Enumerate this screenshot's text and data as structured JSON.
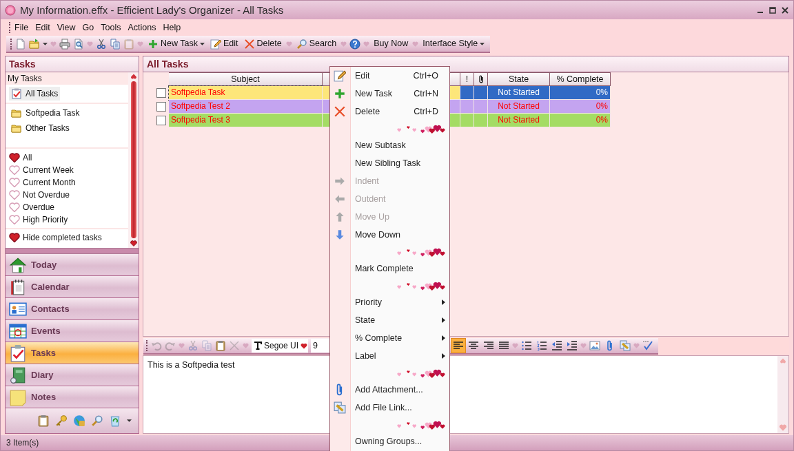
{
  "window": {
    "title": "My Information.effx - Efficient Lady's Organizer - All Tasks"
  },
  "menu": [
    "File",
    "Edit",
    "View",
    "Go",
    "Tools",
    "Actions",
    "Help"
  ],
  "toolbar": [
    {
      "kind": "icon",
      "disabled": false
    },
    {
      "kind": "icon-menu",
      "disabled": false
    },
    {
      "kind": "separator"
    },
    {
      "kind": "icon",
      "disabled": false
    },
    {
      "kind": "icon",
      "disabled": false
    },
    {
      "kind": "separator"
    },
    {
      "kind": "icon",
      "disabled": false
    },
    {
      "kind": "icon",
      "disabled": false
    },
    {
      "kind": "icon",
      "disabled": true
    },
    {
      "kind": "separator"
    },
    {
      "kind": "button-menu",
      "label": "New Task",
      "disabled": false
    },
    {
      "kind": "button",
      "label": "Edit",
      "disabled": false
    },
    {
      "kind": "button",
      "label": "Delete",
      "disabled": false
    },
    {
      "kind": "separator"
    },
    {
      "kind": "button",
      "label": "Search",
      "disabled": false
    },
    {
      "kind": "separator"
    },
    {
      "kind": "icon",
      "disabled": false
    },
    {
      "kind": "separator"
    },
    {
      "kind": "button",
      "label": "Buy Now",
      "disabled": false
    },
    {
      "kind": "separator"
    },
    {
      "kind": "button-menu",
      "label": "Interface Style",
      "disabled": false
    }
  ],
  "sidebar": {
    "title": "Tasks",
    "tree": {
      "header": "My Tasks",
      "items": [
        {
          "kind": "all",
          "label": "All Tasks",
          "selected": true
        },
        {
          "kind": "folder",
          "label": "Softpedia Task",
          "selected": false
        },
        {
          "kind": "folder",
          "label": "Other Tasks",
          "selected": false
        }
      ]
    },
    "filters": [
      {
        "label": "All",
        "selected": true
      },
      {
        "label": "Current Week",
        "selected": false
      },
      {
        "label": "Current Month",
        "selected": false
      },
      {
        "label": "Not Overdue",
        "selected": false
      },
      {
        "label": "Overdue",
        "selected": false
      },
      {
        "label": "High Priority",
        "selected": false
      }
    ],
    "hide_completed": {
      "label": "Hide completed tasks",
      "checked": true
    },
    "nav": [
      {
        "label": "Today",
        "selected": false
      },
      {
        "label": "Calendar",
        "selected": false
      },
      {
        "label": "Contacts",
        "selected": false
      },
      {
        "label": "Events",
        "selected": false
      },
      {
        "label": "Tasks",
        "selected": true
      },
      {
        "label": "Diary",
        "selected": false
      },
      {
        "label": "Notes",
        "selected": false
      }
    ]
  },
  "content": {
    "title": "All Tasks",
    "table": {
      "columns": [
        {
          "kind": "text",
          "label": "Subject"
        },
        {
          "kind": "text",
          "label": "!"
        },
        {
          "kind": "icon"
        },
        {
          "kind": "text",
          "label": "State"
        },
        {
          "kind": "text",
          "label": "% Complete"
        }
      ],
      "rows": [
        {
          "subject": "Softpedia Task",
          "state": "Not Started",
          "complete": "0%",
          "checked": false,
          "selected": true,
          "color": "#fde67a"
        },
        {
          "subject": "Softpedia Test 2",
          "state": "Not Started",
          "complete": "0%",
          "checked": false,
          "selected": false,
          "color": "#c4a4f0"
        },
        {
          "subject": "Softpedia Test 3",
          "state": "Not Started",
          "complete": "0%",
          "checked": false,
          "selected": false,
          "color": "#a4dc64"
        }
      ]
    },
    "editor_toolbar": {
      "left": [
        {
          "kind": "icon",
          "disabled": true
        },
        {
          "kind": "icon",
          "disabled": true
        },
        {
          "kind": "separator"
        },
        {
          "kind": "icon",
          "disabled": true
        },
        {
          "kind": "icon",
          "disabled": true
        },
        {
          "kind": "icon",
          "disabled": false
        },
        {
          "kind": "icon",
          "disabled": true
        },
        {
          "kind": "separator"
        }
      ],
      "font": "Segoe UI",
      "size": "9",
      "right": [
        {
          "kind": "icon",
          "selected": true
        },
        {
          "kind": "icon",
          "selected": false
        },
        {
          "kind": "icon",
          "selected": false
        },
        {
          "kind": "icon",
          "selected": false
        },
        {
          "kind": "separator"
        },
        {
          "kind": "icon",
          "selected": false
        },
        {
          "kind": "icon",
          "selected": false
        },
        {
          "kind": "icon",
          "selected": false
        },
        {
          "kind": "icon",
          "selected": false
        },
        {
          "kind": "separator"
        },
        {
          "kind": "icon",
          "selected": false
        },
        {
          "kind": "icon",
          "selected": false
        },
        {
          "kind": "icon",
          "selected": false
        },
        {
          "kind": "separator"
        },
        {
          "kind": "icon",
          "selected": false
        }
      ]
    },
    "editor_text": "This is a Softpedia test"
  },
  "context_menu": [
    {
      "kind": "item",
      "label": "Edit",
      "shortcut": "Ctrl+O",
      "disabled": false,
      "submenu": false
    },
    {
      "kind": "item",
      "label": "New Task",
      "shortcut": "Ctrl+N",
      "disabled": false,
      "submenu": false
    },
    {
      "kind": "item",
      "label": "Delete",
      "shortcut": "Ctrl+D",
      "disabled": false,
      "submenu": false
    },
    {
      "kind": "separator"
    },
    {
      "kind": "item",
      "label": "New Subtask",
      "disabled": false,
      "submenu": false
    },
    {
      "kind": "item",
      "label": "New Sibling Task",
      "disabled": false,
      "submenu": false
    },
    {
      "kind": "item",
      "label": "Indent",
      "disabled": true,
      "submenu": false
    },
    {
      "kind": "item",
      "label": "Outdent",
      "disabled": true,
      "submenu": false
    },
    {
      "kind": "item",
      "label": "Move Up",
      "disabled": true,
      "submenu": false
    },
    {
      "kind": "item",
      "label": "Move Down",
      "disabled": false,
      "submenu": false
    },
    {
      "kind": "separator"
    },
    {
      "kind": "item",
      "label": "Mark Complete",
      "disabled": false,
      "submenu": false
    },
    {
      "kind": "separator"
    },
    {
      "kind": "item",
      "label": "Priority",
      "disabled": false,
      "submenu": true
    },
    {
      "kind": "item",
      "label": "State",
      "disabled": false,
      "submenu": true
    },
    {
      "kind": "item",
      "label": "% Complete",
      "disabled": false,
      "submenu": true
    },
    {
      "kind": "item",
      "label": "Label",
      "disabled": false,
      "submenu": true
    },
    {
      "kind": "separator"
    },
    {
      "kind": "item",
      "label": "Add Attachment...",
      "disabled": false,
      "submenu": false
    },
    {
      "kind": "item",
      "label": "Add File Link...",
      "disabled": false,
      "submenu": false
    },
    {
      "kind": "separator"
    },
    {
      "kind": "item",
      "label": "Owning Groups...",
      "disabled": false,
      "submenu": false
    }
  ],
  "status_bar": "3 Item(s)"
}
